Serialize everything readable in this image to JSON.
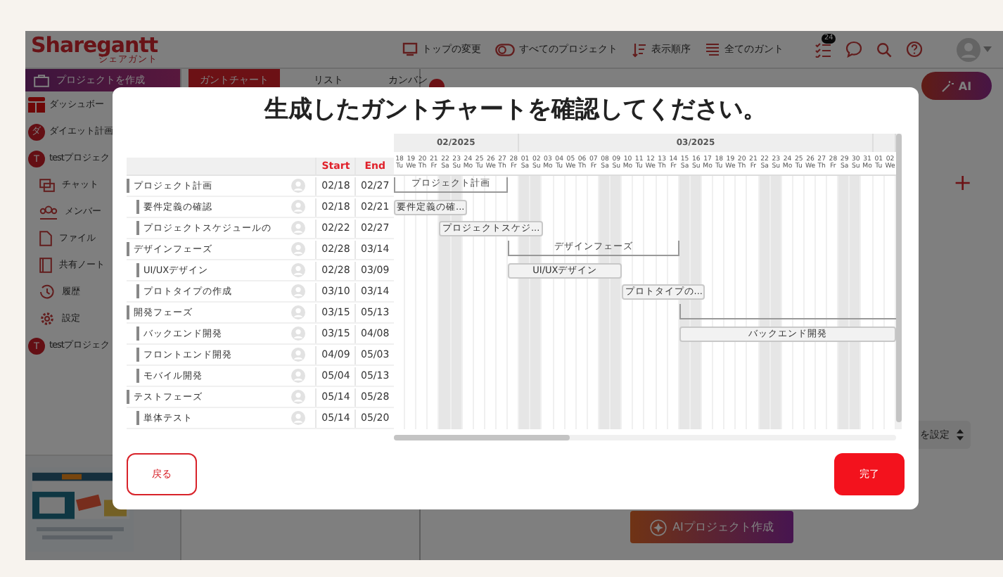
{
  "header": {
    "logo": "Sharegantt",
    "logo_subtitle": "シェアガント",
    "nav": [
      "トップの変更",
      "すべてのプロジェクト",
      "表示順序",
      "全てのガント"
    ],
    "notification_badge": "24"
  },
  "sidebar": {
    "create_button": "プロジェクトを作成",
    "items": [
      {
        "kind": "dashboard",
        "label": "ダッシュボー"
      },
      {
        "kind": "project",
        "initial": "ダ",
        "label": "ダイエット計画"
      },
      {
        "kind": "project",
        "initial": "T",
        "label": "testプロジェク"
      },
      {
        "kind": "chat",
        "label": "チャット"
      },
      {
        "kind": "members",
        "label": "メンバー"
      },
      {
        "kind": "file",
        "label": "ファイル"
      },
      {
        "kind": "notes",
        "label": "共有ノート"
      },
      {
        "kind": "history",
        "label": "履歴"
      },
      {
        "kind": "settings",
        "label": "設定"
      },
      {
        "kind": "project",
        "initial": "T",
        "label": "testプロジェク"
      }
    ]
  },
  "view_tabs": [
    {
      "label": "ガントチャート",
      "selected": true
    },
    {
      "label": "リスト",
      "selected": false
    },
    {
      "label": "カンバン",
      "selected": false
    }
  ],
  "right_panel": {
    "ai_button": "AI",
    "add_button": "+",
    "select_value": "を設定",
    "create_button": "AIプロジェクト作成"
  },
  "modal": {
    "title": "生成したガントチャートを確認してください。",
    "columns": [
      "Start",
      "End"
    ],
    "phases": [
      {
        "name": "プロジェクト計画",
        "start": "02/18",
        "end": "02/27",
        "bar": {
          "kind": "summary",
          "label": "プロジェクト計画"
        },
        "children": [
          {
            "name": "要件定義の確認",
            "start": "02/18",
            "end": "02/21",
            "bar": {
              "kind": "task",
              "label": "要件定義の確..."
            }
          },
          {
            "name": "プロジェクトスケジュールの",
            "start": "02/22",
            "end": "02/27",
            "bar": {
              "kind": "task",
              "label": "プロジェクトスケジ..."
            }
          }
        ]
      },
      {
        "name": "デザインフェーズ",
        "start": "02/28",
        "end": "03/14",
        "bar": {
          "kind": "summary",
          "label": "デザインフェーズ"
        },
        "children": [
          {
            "name": "UI/UXデザイン",
            "start": "02/28",
            "end": "03/09",
            "bar": {
              "kind": "task",
              "label": "UI/UXデザイン"
            }
          },
          {
            "name": "プロトタイプの作成",
            "start": "03/10",
            "end": "03/14",
            "bar": {
              "kind": "task",
              "label": "プロトタイプの..."
            }
          }
        ]
      },
      {
        "name": "開発フェーズ",
        "start": "03/15",
        "end": "05/13",
        "bar": {
          "kind": "summary"
        },
        "children": [
          {
            "name": "バックエンド開発",
            "start": "03/15",
            "end": "04/08",
            "bar": {
              "kind": "task",
              "label": "バックエンド開発"
            }
          },
          {
            "name": "フロントエンド開発",
            "start": "04/09",
            "end": "05/03"
          },
          {
            "name": "モバイル開発",
            "start": "05/04",
            "end": "05/13"
          }
        ]
      },
      {
        "name": "テストフェーズ",
        "start": "05/14",
        "end": "05/28",
        "children": [
          {
            "name": "単体テスト",
            "start": "05/14",
            "end": "05/20"
          }
        ]
      }
    ],
    "timeline": {
      "months": [
        {
          "label": "02/2025",
          "days": [
            {
              "day": "18",
              "weekday": "Tu",
              "weekend": false
            },
            {
              "day": "19",
              "weekday": "We",
              "weekend": false
            },
            {
              "day": "20",
              "weekday": "Th",
              "weekend": false
            },
            {
              "day": "21",
              "weekday": "Fr",
              "weekend": false
            },
            {
              "day": "22",
              "weekday": "Sa",
              "weekend": true
            },
            {
              "day": "23",
              "weekday": "Su",
              "weekend": true
            },
            {
              "day": "24",
              "weekday": "Mo",
              "weekend": false
            },
            {
              "day": "25",
              "weekday": "Tu",
              "weekend": false
            },
            {
              "day": "26",
              "weekday": "We",
              "weekend": false
            },
            {
              "day": "27",
              "weekday": "Th",
              "weekend": false
            },
            {
              "day": "28",
              "weekday": "Fr",
              "weekend": false
            }
          ]
        },
        {
          "label": "03/2025",
          "days": [
            {
              "day": "01",
              "weekday": "Sa",
              "weekend": true
            },
            {
              "day": "02",
              "weekday": "Su",
              "weekend": true
            },
            {
              "day": "03",
              "weekday": "Mo",
              "weekend": false
            },
            {
              "day": "04",
              "weekday": "Tu",
              "weekend": false
            },
            {
              "day": "05",
              "weekday": "We",
              "weekend": false
            },
            {
              "day": "06",
              "weekday": "Th",
              "weekend": false
            },
            {
              "day": "07",
              "weekday": "Fr",
              "weekend": false
            },
            {
              "day": "08",
              "weekday": "Sa",
              "weekend": true
            },
            {
              "day": "09",
              "weekday": "Su",
              "weekend": true
            },
            {
              "day": "10",
              "weekday": "Mo",
              "weekend": false
            },
            {
              "day": "11",
              "weekday": "Tu",
              "weekend": false
            },
            {
              "day": "12",
              "weekday": "We",
              "weekend": false
            },
            {
              "day": "13",
              "weekday": "Th",
              "weekend": false
            },
            {
              "day": "14",
              "weekday": "Fr",
              "weekend": false
            },
            {
              "day": "15",
              "weekday": "Sa",
              "weekend": true
            },
            {
              "day": "16",
              "weekday": "Su",
              "weekend": true
            },
            {
              "day": "17",
              "weekday": "Mo",
              "weekend": false
            },
            {
              "day": "18",
              "weekday": "Tu",
              "weekend": false
            },
            {
              "day": "19",
              "weekday": "We",
              "weekend": false
            },
            {
              "day": "20",
              "weekday": "Th",
              "weekend": false
            },
            {
              "day": "21",
              "weekday": "Fr",
              "weekend": false
            },
            {
              "day": "22",
              "weekday": "Sa",
              "weekend": true
            },
            {
              "day": "23",
              "weekday": "Su",
              "weekend": true
            },
            {
              "day": "24",
              "weekday": "Mo",
              "weekend": false
            },
            {
              "day": "25",
              "weekday": "Tu",
              "weekend": false
            },
            {
              "day": "26",
              "weekday": "We",
              "weekend": false
            },
            {
              "day": "27",
              "weekday": "Th",
              "weekend": false
            },
            {
              "day": "28",
              "weekday": "Fr",
              "weekend": false
            },
            {
              "day": "29",
              "weekday": "Sa",
              "weekend": true
            },
            {
              "day": "30",
              "weekday": "Su",
              "weekend": true
            },
            {
              "day": "31",
              "weekday": "Mo",
              "weekend": false
            }
          ]
        },
        {
          "days": [
            {
              "day": "01",
              "weekday": "Tu",
              "weekend": false
            },
            {
              "day": "02",
              "weekday": "We",
              "weekend": false
            }
          ]
        }
      ]
    },
    "back_button": "戻る",
    "done_button": "完了"
  }
}
